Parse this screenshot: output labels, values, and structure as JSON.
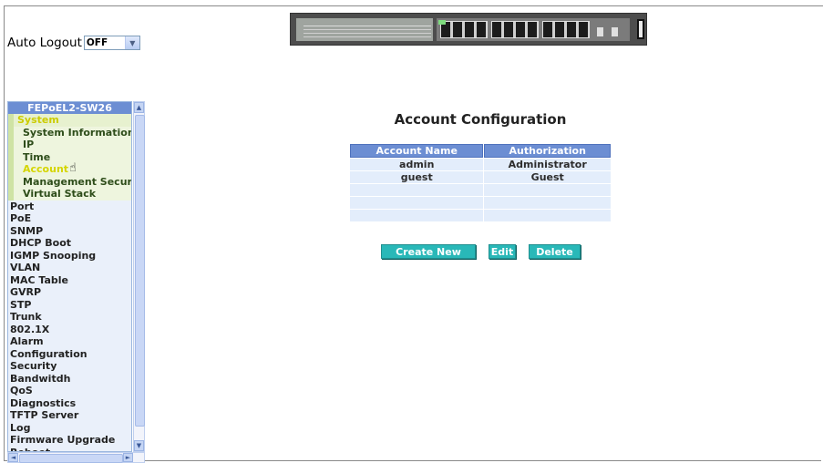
{
  "auto_logout": {
    "label": "Auto Logout",
    "value": "OFF"
  },
  "sidebar": {
    "title": "FEPoEL2-SW26",
    "items": [
      {
        "label": "System",
        "kind": "sys"
      },
      {
        "label": "System Information",
        "kind": "sub"
      },
      {
        "label": "IP",
        "kind": "sub"
      },
      {
        "label": "Time",
        "kind": "sub"
      },
      {
        "label": "Account",
        "kind": "sub-active"
      },
      {
        "label": "Management Securit",
        "kind": "sub"
      },
      {
        "label": "Virtual Stack",
        "kind": "sub"
      },
      {
        "label": "Port",
        "kind": "top"
      },
      {
        "label": "PoE",
        "kind": "top"
      },
      {
        "label": "SNMP",
        "kind": "top"
      },
      {
        "label": "DHCP Boot",
        "kind": "top"
      },
      {
        "label": "IGMP Snooping",
        "kind": "top"
      },
      {
        "label": "VLAN",
        "kind": "top"
      },
      {
        "label": "MAC Table",
        "kind": "top"
      },
      {
        "label": "GVRP",
        "kind": "top"
      },
      {
        "label": "STP",
        "kind": "top"
      },
      {
        "label": "Trunk",
        "kind": "top"
      },
      {
        "label": "802.1X",
        "kind": "top"
      },
      {
        "label": "Alarm",
        "kind": "top"
      },
      {
        "label": "Configuration",
        "kind": "top"
      },
      {
        "label": "Security",
        "kind": "top"
      },
      {
        "label": "Bandwitdh",
        "kind": "top"
      },
      {
        "label": "QoS",
        "kind": "top"
      },
      {
        "label": "Diagnostics",
        "kind": "top"
      },
      {
        "label": "TFTP Server",
        "kind": "top"
      },
      {
        "label": "Log",
        "kind": "top"
      },
      {
        "label": "Firmware Upgrade",
        "kind": "top"
      },
      {
        "label": "Reboot",
        "kind": "top"
      }
    ]
  },
  "main": {
    "title": "Account Configuration",
    "table": {
      "headers": [
        "Account Name",
        "Authorization"
      ],
      "rows": [
        [
          "admin",
          "Administrator"
        ],
        [
          "guest",
          "Guest"
        ],
        [
          "",
          ""
        ],
        [
          "",
          ""
        ],
        [
          "",
          ""
        ]
      ]
    },
    "buttons": {
      "create": "Create New",
      "edit": "Edit",
      "delete": "Delete"
    }
  },
  "colors": {
    "header_blue": "#6c8ed3",
    "button_teal": "#29b8b8",
    "active_item": "#d5d500"
  },
  "icons": [
    "dropdown-arrow-icon",
    "scroll-up-icon",
    "scroll-down-icon",
    "scroll-left-icon",
    "scroll-right-icon",
    "hand-cursor-icon",
    "switch-device-image"
  ]
}
